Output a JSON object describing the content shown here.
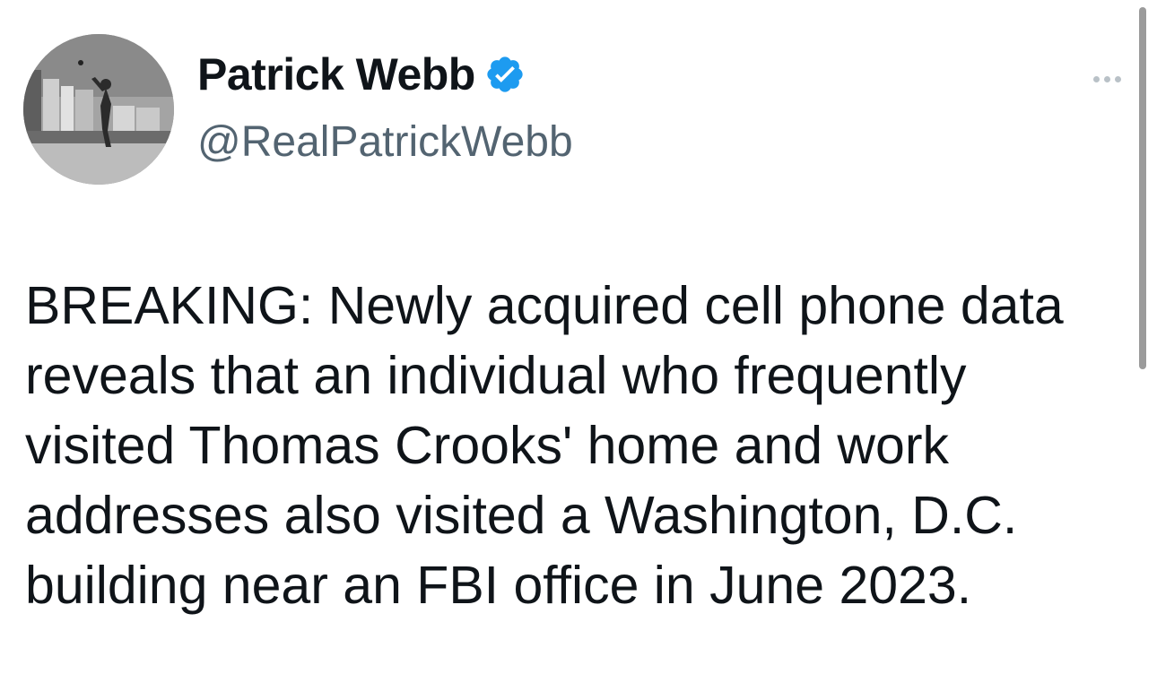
{
  "tweet": {
    "author": {
      "display_name": "Patrick Webb",
      "handle": "@RealPatrickWebb",
      "verified": true
    },
    "text": "BREAKING: Newly acquired cell phone data\nreveals that an individual who frequently\nvisited Thomas Crooks' home and work\naddresses also visited a Washington, D.C.\nbuilding near an FBI office in June 2023.",
    "more_menu_icon": "ellipsis-icon"
  },
  "colors": {
    "text_primary": "#0f1419",
    "text_secondary": "#536471",
    "verified_blue": "#1d9bf0",
    "more_dots": "#b9c1c7"
  }
}
